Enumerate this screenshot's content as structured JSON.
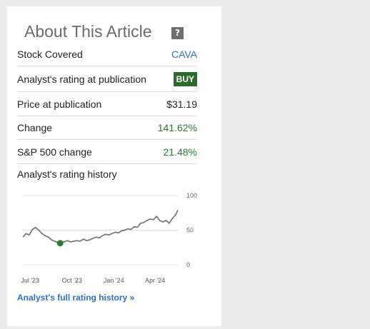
{
  "panel": {
    "title": "About This Article",
    "help_glyph": "?"
  },
  "rows": {
    "stock": {
      "label": "Stock Covered",
      "value": "CAVA"
    },
    "rating": {
      "label": "Analyst's rating at publication",
      "value": "BUY"
    },
    "price": {
      "label": "Price at publication",
      "value": "$31.19"
    },
    "change": {
      "label": "Change",
      "value": "141.62%"
    },
    "sp500": {
      "label": "S&P 500 change",
      "value": "21.48%"
    }
  },
  "history": {
    "title": "Analyst's rating history",
    "full_link": "Analyst's full rating history »"
  },
  "colors": {
    "link": "#2d6fce",
    "positive": "#2c7a2c",
    "badge": "#2c6b2c",
    "line": "#7a7a7a",
    "marker": "#2e7d32"
  },
  "chart_data": {
    "type": "line",
    "ylim": [
      0,
      100
    ],
    "y_ticks": [
      "100",
      "50",
      "0"
    ],
    "x_ticks": [
      {
        "label": "Jul '23",
        "date": "2023-07-01"
      },
      {
        "label": "Oct '23",
        "date": "2023-10-01"
      },
      {
        "label": "Jan '24",
        "date": "2024-01-01"
      },
      {
        "label": "Apr '24",
        "date": "2024-04-01"
      }
    ],
    "x_range": [
      "2023-06-15",
      "2024-05-21"
    ],
    "grid": true,
    "series": [
      {
        "points": [
          [
            "2023-06-15",
            40
          ],
          [
            "2023-06-22",
            45
          ],
          [
            "2023-06-29",
            43
          ],
          [
            "2023-07-06",
            51
          ],
          [
            "2023-07-13",
            54
          ],
          [
            "2023-07-20",
            50
          ],
          [
            "2023-07-27",
            45
          ],
          [
            "2023-08-03",
            42
          ],
          [
            "2023-08-10",
            40
          ],
          [
            "2023-08-17",
            36
          ],
          [
            "2023-08-24",
            34
          ],
          [
            "2023-08-31",
            32
          ],
          [
            "2023-09-07",
            34
          ],
          [
            "2023-09-14",
            33
          ],
          [
            "2023-09-21",
            35
          ],
          [
            "2023-09-28",
            33
          ],
          [
            "2023-10-05",
            34
          ],
          [
            "2023-10-12",
            35
          ],
          [
            "2023-10-19",
            34
          ],
          [
            "2023-10-26",
            37
          ],
          [
            "2023-11-02",
            35
          ],
          [
            "2023-11-09",
            36
          ],
          [
            "2023-11-16",
            38
          ],
          [
            "2023-11-23",
            40
          ],
          [
            "2023-11-30",
            39
          ],
          [
            "2023-12-07",
            42
          ],
          [
            "2023-12-14",
            44
          ],
          [
            "2023-12-21",
            43
          ],
          [
            "2023-12-28",
            45
          ],
          [
            "2024-01-04",
            47
          ],
          [
            "2024-01-11",
            46
          ],
          [
            "2024-01-18",
            49
          ],
          [
            "2024-01-25",
            50
          ],
          [
            "2024-02-01",
            52
          ],
          [
            "2024-02-08",
            51
          ],
          [
            "2024-02-15",
            55
          ],
          [
            "2024-02-22",
            54
          ],
          [
            "2024-02-29",
            60
          ],
          [
            "2024-03-07",
            61
          ],
          [
            "2024-03-14",
            64
          ],
          [
            "2024-03-21",
            66
          ],
          [
            "2024-03-28",
            65
          ],
          [
            "2024-04-04",
            70
          ],
          [
            "2024-04-11",
            64
          ],
          [
            "2024-04-18",
            62
          ],
          [
            "2024-04-25",
            64
          ],
          [
            "2024-05-02",
            60
          ],
          [
            "2024-05-09",
            67
          ],
          [
            "2024-05-16",
            72
          ],
          [
            "2024-05-21",
            79
          ]
        ]
      }
    ],
    "marker": {
      "date": "2023-09-05",
      "value": 31.19
    }
  }
}
